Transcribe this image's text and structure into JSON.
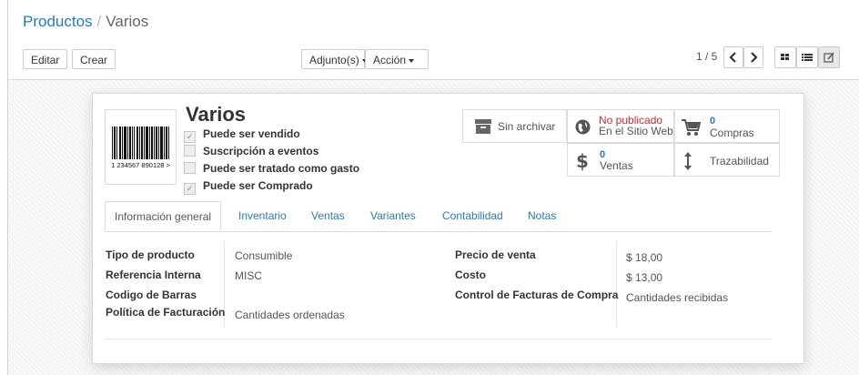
{
  "breadcrumb": {
    "parent": "Productos",
    "separator": "/",
    "current": "Varios"
  },
  "toolbar": {
    "edit_label": "Editar",
    "create_label": "Crear",
    "attachments_label": "Adjunto(s)",
    "action_label": "Acción",
    "pager": "1 / 5"
  },
  "product": {
    "name": "Varios",
    "barcode_text": "1 234567 890128 >",
    "options": [
      {
        "label": "Puede ser vendido",
        "checked": true
      },
      {
        "label": "Suscripción a eventos",
        "checked": false
      },
      {
        "label": "Puede ser tratado como gasto",
        "checked": false
      },
      {
        "label": "Puede ser Comprado",
        "checked": true
      }
    ]
  },
  "smart_buttons": {
    "archive": {
      "label": "Sin archivar",
      "icon": "archive-icon"
    },
    "website": {
      "line1": "No publicado",
      "line2": "En el Sitio Web",
      "icon": "globe-icon",
      "color": "#c9302c"
    },
    "purchases": {
      "count": "0",
      "label": "Compras",
      "icon": "shopping-cart-icon"
    },
    "sales": {
      "count": "0",
      "label": "Ventas",
      "icon": "dollar-icon"
    },
    "traceability": {
      "label": "Trazabilidad",
      "icon": "arrows-vertical-icon"
    }
  },
  "tabs": [
    "Información general",
    "Inventario",
    "Ventas",
    "Variantes",
    "Contabilidad",
    "Notas"
  ],
  "general": {
    "left": [
      {
        "label": "Tipo de producto",
        "value": "Consumible"
      },
      {
        "label": "Referencia Interna",
        "value": "MISC"
      },
      {
        "label": "Codigo de Barras",
        "value": ""
      },
      {
        "label": "Política de Facturación",
        "value": "Cantidades ordenadas"
      }
    ],
    "right": [
      {
        "label": "Precio de venta",
        "value": "$ 18,00"
      },
      {
        "label": "Costo",
        "value": "$ 13,00"
      },
      {
        "label": "Control de Facturas de Compra",
        "value": "Cantidades recibidas"
      }
    ]
  },
  "colors": {
    "link": "#2a7ab8",
    "unpublished": "#c9302c"
  }
}
